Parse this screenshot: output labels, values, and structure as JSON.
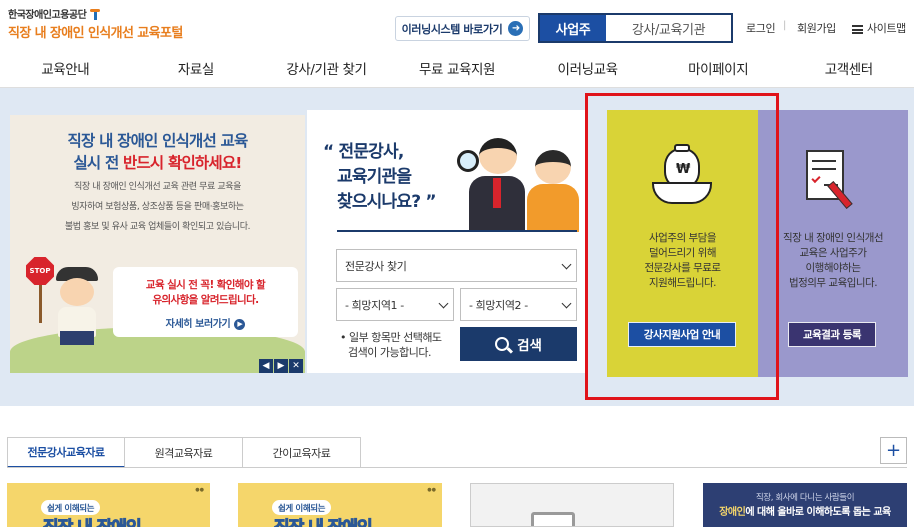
{
  "header": {
    "org_name": "한국장애인고용공단",
    "portal_name": "직장 내 장애인 인식개선 교육포털",
    "elearning_link": "이러닝시스템 바로가기",
    "user_types": [
      "사업주",
      "강사/교육기관"
    ],
    "util_links": [
      "로그인",
      "회원가입",
      "사이트맵"
    ]
  },
  "nav": {
    "items": [
      "교육안내",
      "자료실",
      "강사/기관 찾기",
      "무료 교육지원",
      "이러닝교육",
      "마이페이지",
      "고객센터"
    ]
  },
  "banner_left": {
    "title_line1": "직장 내 장애인 인식개선 교육",
    "title_line2_prefix": "실시 전 ",
    "title_line2_highlight": "반드시 확인하세요!",
    "desc_line1": "직장 내 장애인 인식개선 교육 관련 무료 교육을",
    "desc_line2": "빙자하여 보험상품, 상조상품 등을 판매·홍보하는",
    "desc_line3": "불법 홍보 및 유사 교육 업체들이 확인되고 있습니다.",
    "stop_label": "STOP",
    "notice_line1": "교육 실시 전 꼭! 확인해야 할",
    "notice_line2": "유의사항을 알려드립니다.",
    "notice_more": "자세히 보러가기",
    "slide_controls": [
      "◀",
      "▶",
      "✕"
    ]
  },
  "search": {
    "question_line1": "“ 전문강사,",
    "question_line2": "교육기관을",
    "question_line3": "찾으시나요? ”",
    "type_select": "전문강사 찾기",
    "region1": "- 희망지역1 -",
    "region2": "- 희망지역2 -",
    "note_line1": "• 일부 항목만 선택해도",
    "note_line2": "검색이 가능합니다.",
    "button": "검색"
  },
  "card_yellow": {
    "text_line1": "사업주의 부담을",
    "text_line2": "덜어드리기 위해",
    "text_line3": "전문강사를 무료로",
    "text_line4": "지원해드립니다.",
    "icon_symbol": "₩",
    "button": "강사지원사업 안내",
    "color": "#d9d337",
    "button_color": "#1c4fa3"
  },
  "card_purple": {
    "text_line1": "직장 내 장애인 인식개선",
    "text_line2": "교육은 사업주가",
    "text_line3": "이행해야하는",
    "text_line4": "법정의무 교육입니다.",
    "button": "교육결과 등록",
    "color": "#9a98cc",
    "button_color": "#3a3470"
  },
  "tabs": {
    "items": [
      "전문강사교육자료",
      "원격교육자료",
      "간이교육자료"
    ],
    "active": 0,
    "more_symbol": "+"
  },
  "thumbnails": {
    "badge1": "쉽게 이해되는",
    "title1": "직장 내 장애인",
    "badge2": "쉽게 이해되는",
    "title2": "직장 내 장애인",
    "card4_line1": "직장, 회사에 다니는 사람들이",
    "card4_line2_highlight": "장애인",
    "card4_line2_rest": "에 대해 올바로 이해하도록 돕는 교육"
  },
  "colors": {
    "brand_navy": "#1b3a6b",
    "brand_blue": "#1c4fa3",
    "brand_orange": "#e87e1e",
    "alert_red": "#d8242c",
    "highlight_box": "#e0131a"
  }
}
